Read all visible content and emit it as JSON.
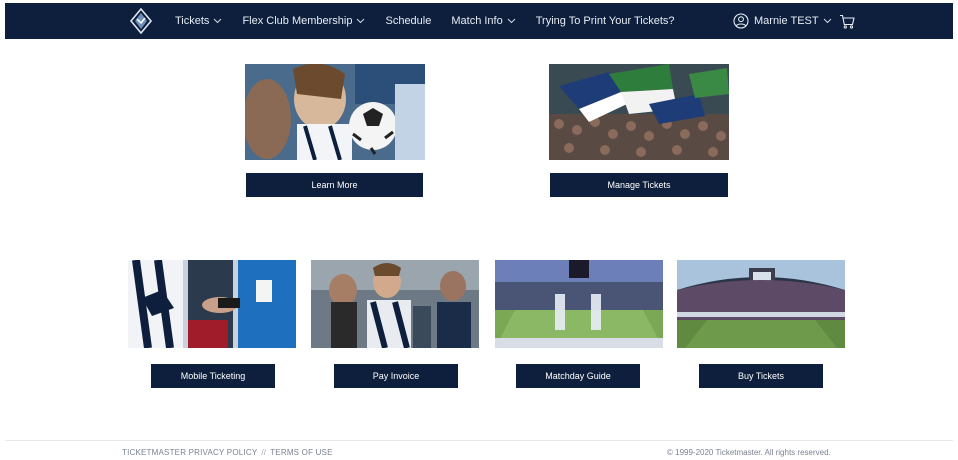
{
  "nav": {
    "items": [
      {
        "label": "Tickets",
        "has_dropdown": true
      },
      {
        "label": "Flex Club Membership",
        "has_dropdown": true
      },
      {
        "label": "Schedule",
        "has_dropdown": false
      },
      {
        "label": "Match Info",
        "has_dropdown": true
      },
      {
        "label": "Trying To Print Your Tickets?",
        "has_dropdown": false
      }
    ],
    "user_name": "Marnie TEST"
  },
  "tiles_top": [
    {
      "button": "Learn More"
    },
    {
      "button": "Manage Tickets"
    }
  ],
  "tiles_bottom": [
    {
      "button": "Mobile Ticketing"
    },
    {
      "button": "Pay Invoice"
    },
    {
      "button": "Matchday Guide"
    },
    {
      "button": "Buy Tickets"
    }
  ],
  "footer": {
    "privacy": "TICKETMASTER PRIVACY POLICY",
    "separator": "//",
    "terms": "TERMS OF USE",
    "copyright": "© 1999-2020 Ticketmaster. All rights reserved."
  },
  "colors": {
    "nav_bg": "#0d1f3c",
    "button_bg": "#0d1f3c",
    "page_bg": "#ffffff"
  }
}
